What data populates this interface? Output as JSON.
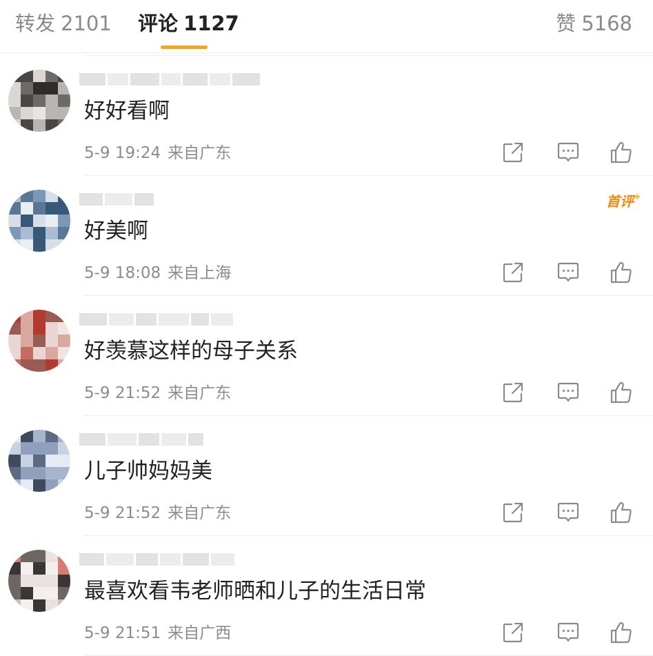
{
  "tabs": {
    "repost": {
      "label": "转发",
      "count": "2101"
    },
    "comments": {
      "label": "评论",
      "count": "1127"
    },
    "likes": {
      "label": "赞",
      "count": "5168"
    }
  },
  "colors": {
    "accent": "#f7a41c",
    "badge": "#f08a12",
    "text_primary": "#222222",
    "text_secondary": "#8c8c8c",
    "icon": "#8a8a8a"
  },
  "icons": {
    "share": "share-icon",
    "reply": "comment-icon",
    "like": "thumbs-up-icon"
  },
  "comments": [
    {
      "text": "好好看啊",
      "time": "5-9 19:24",
      "location": "来自广东",
      "badge": "",
      "avatar_palette": [
        "#d9d6d4",
        "#b9b5b2",
        "#6d6a68",
        "#2f2d2c",
        "#e8e6e4",
        "#4a4746"
      ]
    },
    {
      "text": "好美啊",
      "time": "5-9 18:08",
      "location": "来自上海",
      "badge": "首评",
      "avatar_palette": [
        "#a9bcd1",
        "#7d97b6",
        "#5a7798",
        "#d7dee7",
        "#e9eef3",
        "#38587a"
      ]
    },
    {
      "text": "好羡慕这样的母子关系",
      "time": "5-9 21:52",
      "location": "来自广东",
      "badge": "",
      "avatar_palette": [
        "#e9d6d2",
        "#c76a60",
        "#b23a30",
        "#f1e4e1",
        "#9b5b55",
        "#d9a8a1"
      ]
    },
    {
      "text": "儿子帅妈妈美",
      "time": "5-9 21:52",
      "location": "来自广东",
      "badge": "",
      "avatar_palette": [
        "#c9d2e3",
        "#8fa0bd",
        "#3e4a5e",
        "#e6ebf3",
        "#a7b5cc",
        "#5c6a82"
      ]
    },
    {
      "text": "最喜欢看韦老师晒和儿子的生活日常",
      "time": "5-9 21:51",
      "location": "来自广西",
      "badge": "",
      "avatar_palette": [
        "#e8e3e0",
        "#3a3634",
        "#c9bfbb",
        "#f3efed",
        "#d97c74",
        "#6d6664"
      ]
    }
  ]
}
